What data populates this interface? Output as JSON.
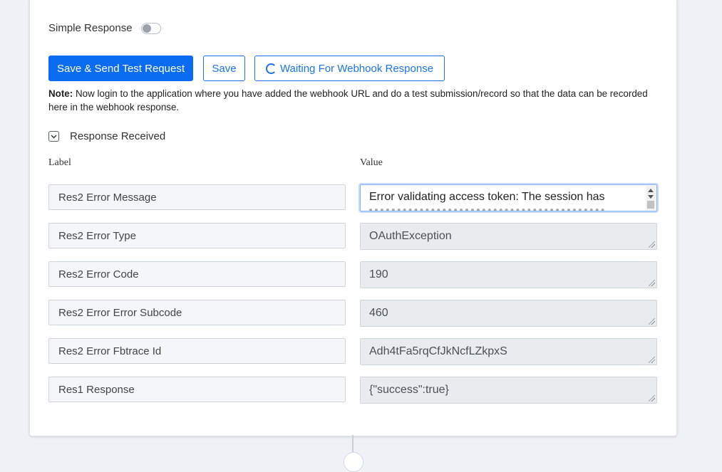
{
  "simple_response": {
    "label": "Simple Response",
    "enabled": false
  },
  "buttons": {
    "save_send": "Save & Send Test Request",
    "save": "Save",
    "waiting": "Waiting For Webhook Response"
  },
  "note": {
    "prefix": "Note:",
    "text": "Now login to the application where you have added the webhook URL and do a test submission/record so that the data can be recorded here in the webhook response."
  },
  "response_section": {
    "label": "Response Received",
    "expanded": true
  },
  "columns": {
    "label": "Label",
    "value": "Value"
  },
  "rows": [
    {
      "label": "Res2 Error Message",
      "value": "Error validating access token: The session has"
    },
    {
      "label": "Res2 Error Type",
      "value": "OAuthException"
    },
    {
      "label": "Res2 Error Code",
      "value": "190"
    },
    {
      "label": "Res2 Error Error Subcode",
      "value": "460"
    },
    {
      "label": "Res2 Error Fbtrace Id",
      "value": "Adh4tFa5rqCfJkNcfLZkpxS"
    },
    {
      "label": "Res1 Response",
      "value": "{\"success\":true}"
    }
  ],
  "colors": {
    "primary": "#0a6cf0",
    "outline": "#1a73e8",
    "readonly_bg": "#e9ecef"
  }
}
